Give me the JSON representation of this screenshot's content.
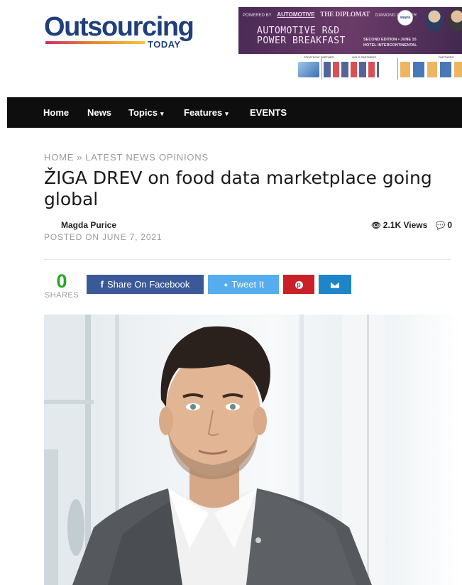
{
  "logo": {
    "main": "Outsourcing",
    "sub": "TODAY"
  },
  "banner": {
    "powered_by": "POWERED BY",
    "automotive": "AUTOMOTIVE",
    "diplomat": "THE DIPLOMAT",
    "diamond": "DIAMOND PARTNER",
    "wayra": "wayra",
    "title_line1": "AUTOMOTIVE R&D",
    "title_line2": "POWER BREAKFAST",
    "edition_line1": "SECOND EDITION • JUNE 15",
    "edition_line2": "HOTEL INTERCONTINENTAL",
    "strategic": "STRATEGIC PARTNER",
    "gold": "GOLD PARTNERS",
    "partners": "PARTNERS"
  },
  "nav": {
    "items": [
      {
        "label": "Home"
      },
      {
        "label": "News"
      },
      {
        "label": "Topics",
        "dropdown": true
      },
      {
        "label": "Features",
        "dropdown": true
      },
      {
        "label": "EVENTS"
      }
    ],
    "chevron": "⌄"
  },
  "breadcrumb": {
    "home": "HOME",
    "sep": "»",
    "section": "LATEST NEWS OPINIONS"
  },
  "article": {
    "title": "ŽIGA DREV on food data marketplace going global",
    "author": "Magda Purice",
    "posted": "POSTED ON JUNE 7, 2021",
    "views": "2.1K Views",
    "comments": "0"
  },
  "share": {
    "count": "0",
    "label": "SHARES",
    "facebook": "Share On Facebook",
    "twitter": "Tweet It",
    "facebook_icon": "f",
    "twitter_icon": "🐦"
  },
  "colors": {
    "nav_bg": "#0e0e0e",
    "logo_blue": "#1f3f7d",
    "facebook": "#3b5998",
    "twitter": "#55acee",
    "pinterest": "#cb2027",
    "email": "#1e86c8",
    "share_green": "#2aa527"
  }
}
